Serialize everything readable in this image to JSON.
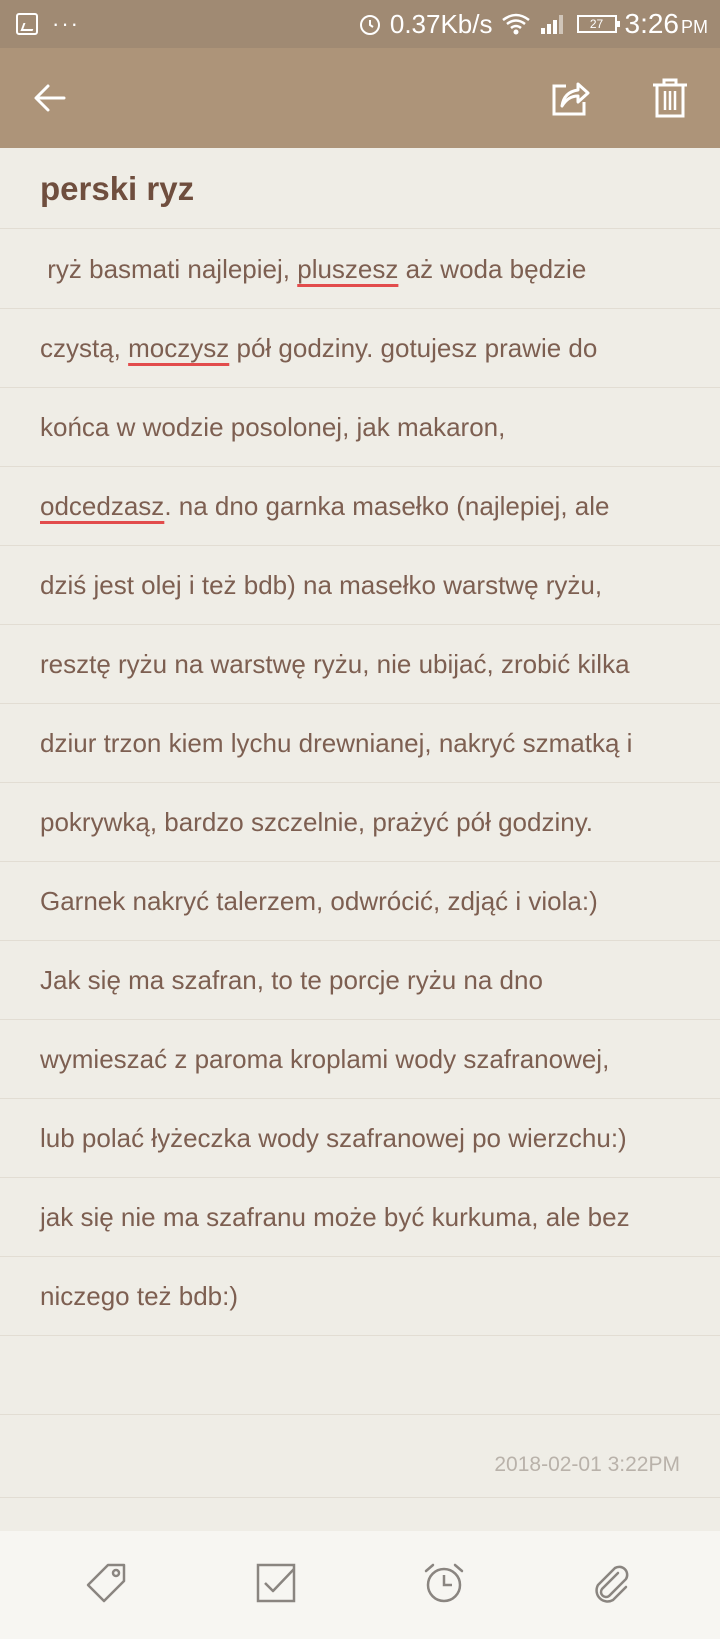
{
  "status_bar": {
    "net_speed": "0.37Kb/s",
    "battery_level": "27",
    "time": "3:26",
    "ampm": "PM",
    "icons": [
      "screenshot-icon",
      "more-dots-icon",
      "alarm-icon",
      "wifi-icon",
      "signal-icon",
      "battery-icon"
    ]
  },
  "toolbar": {
    "back_icon": "back-arrow-icon",
    "share_icon": "share-icon",
    "delete_icon": "trash-icon"
  },
  "note": {
    "title": "perski ryz",
    "lines": [
      [
        {
          "t": " ryż basmati najlepiej, "
        },
        {
          "t": "pluszesz",
          "u": true
        },
        {
          "t": " aż woda będzie"
        }
      ],
      [
        {
          "t": "czystą, "
        },
        {
          "t": "moczysz",
          "u": true
        },
        {
          "t": " pół godziny. gotujesz prawie do"
        }
      ],
      [
        {
          "t": "końca w wodzie posolonej, jak makaron,"
        }
      ],
      [
        {
          "t": "odcedzasz",
          "u": true
        },
        {
          "t": ". na dno garnka masełko (najlepiej, ale"
        }
      ],
      [
        {
          "t": "dziś jest olej i też bdb) na masełko warstwę ryżu,"
        }
      ],
      [
        {
          "t": "resztę ryżu na warstwę ryżu, nie ubijać, zrobić kilka"
        }
      ],
      [
        {
          "t": "dziur trzon kiem lychu drewnianej, nakryć szmatką i"
        }
      ],
      [
        {
          "t": "pokrywką, bardzo szczelnie, prażyć pół godziny."
        }
      ],
      [
        {
          "t": "Garnek nakryć talerzem, odwrócić, zdjąć i viola:)"
        }
      ],
      [
        {
          "t": "Jak się ma szafran, to te porcje ryżu na dno"
        }
      ],
      [
        {
          "t": "wymieszać z paroma kroplami wody szafranowej,"
        }
      ],
      [
        {
          "t": "lub polać łyżeczka wody szafranowej po wierzchu:)"
        }
      ],
      [
        {
          "t": "jak się nie ma szafranu może być kurkuma, ale bez"
        }
      ],
      [
        {
          "t": "niczego też bdb:)"
        }
      ]
    ],
    "timestamp": "2018-02-01 3:22PM"
  },
  "bottom_bar": {
    "icons": [
      "tag-icon",
      "checkbox-icon",
      "alarm-clock-icon",
      "attachment-icon"
    ]
  },
  "colors": {
    "status_bar": "#a08a73",
    "app_bar": "#ad9479",
    "background": "#efede6",
    "title": "#6f4e3e",
    "text": "#7d5f51",
    "spellcheck_underline": "#e24c4c"
  }
}
